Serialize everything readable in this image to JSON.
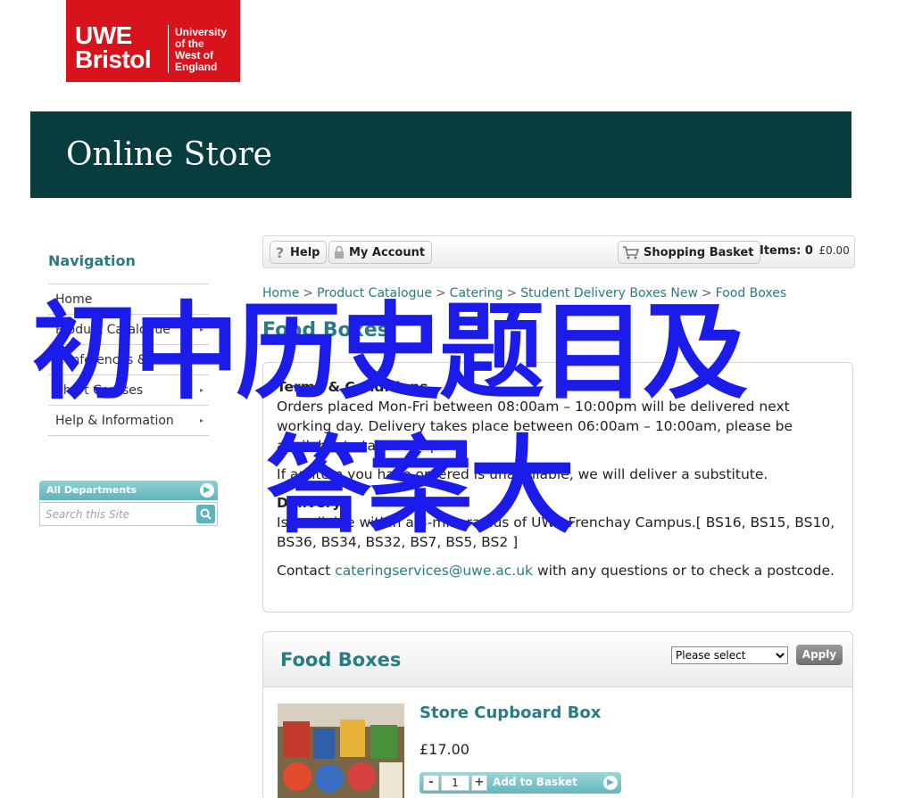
{
  "logo": {
    "line1": "UWE",
    "line2": "Bristol",
    "sub1": "University",
    "sub2": "of the",
    "sub3": "West of",
    "sub4": "England",
    "color": "#d9131c"
  },
  "banner": {
    "title": "Online Store",
    "color": "#073d3f"
  },
  "navigation": {
    "heading": "Navigation",
    "items": [
      {
        "label": "Home"
      },
      {
        "label": "Product Catalogue"
      },
      {
        "label": "Conferences & Events"
      },
      {
        "label": "Short Courses"
      },
      {
        "label": "Help & Information"
      }
    ]
  },
  "search": {
    "department": "All Departments",
    "placeholder": "Search this Site"
  },
  "toolbar": {
    "help": "Help",
    "account": "My Account",
    "basket": "Shopping Basket",
    "items_label": "Items:",
    "items_count": "0",
    "items_total": "£0.00"
  },
  "breadcrumb": [
    "Home",
    "Product Catalogue",
    "Catering",
    "Student Delivery Boxes New",
    "Food Boxes"
  ],
  "page_title": "Food Boxes",
  "terms": {
    "heading": "Terms & Conditions",
    "orders": "Orders placed Mon-Fri between 08:00am – 10:00pm will be delivered next working day. Delivery takes place between 06:00am – 10:00am, please be available to take receipt.",
    "substitute": "If an item you have ordered is unavailable, we will deliver a substitute.",
    "delivery_heading": "Delivery",
    "delivery_text": "Is available within a 3-mile radius of UWE Frenchay Campus.[ BS16, BS15, BS10, BS36, BS34, BS32, BS7, BS5, BS2 ]",
    "contact_pre": "Contact",
    "contact_email": "cateringservices@uwe.ac.uk",
    "contact_post": "with any questions or to check a postcode."
  },
  "listing": {
    "title": "Food Boxes",
    "sort_selected": "Please select",
    "apply": "Apply",
    "product": {
      "name": "Store Cupboard Box",
      "price": "£17.00",
      "quantity": "1",
      "add_label": "Add to Basket"
    }
  },
  "overlay": {
    "line1": "初中历史题目及",
    "line2": "答案大"
  },
  "colors": {
    "accent": "#2a7c84",
    "overlay": "#1b1bea"
  }
}
